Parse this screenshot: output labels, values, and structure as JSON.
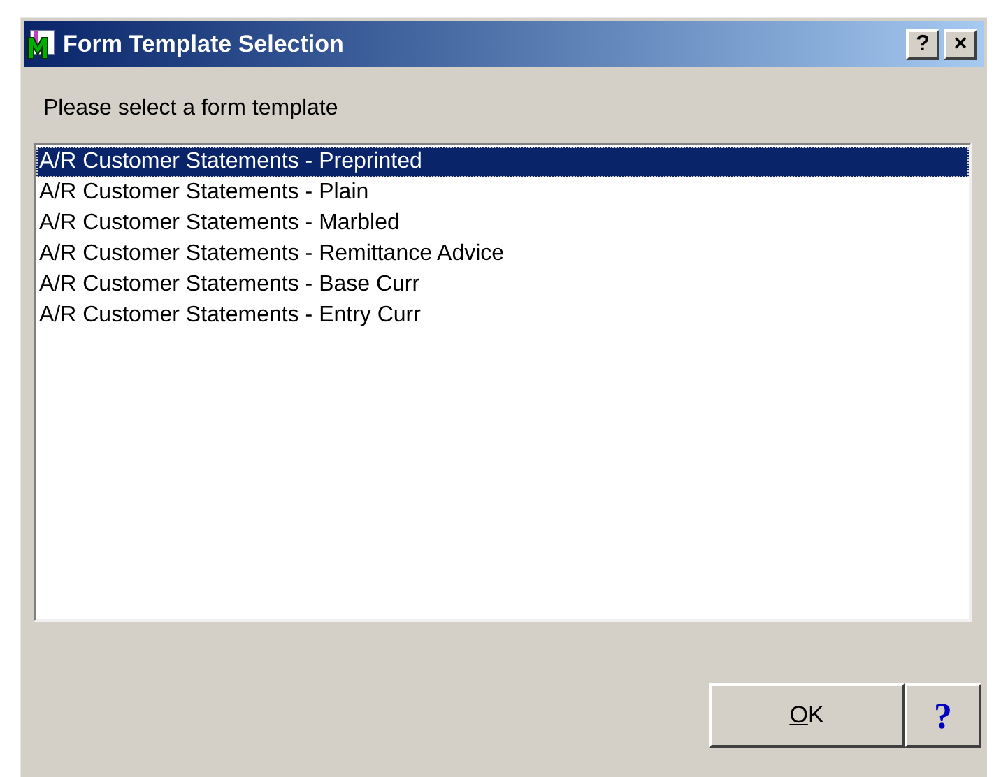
{
  "window": {
    "title": "Form Template Selection",
    "title_buttons": [
      "?",
      "×"
    ]
  },
  "prompt": "Please select a form template",
  "templates": [
    {
      "label": "A/R Customer Statements - Preprinted",
      "selected": true
    },
    {
      "label": "A/R Customer Statements - Plain",
      "selected": false
    },
    {
      "label": "A/R Customer Statements - Marbled",
      "selected": false
    },
    {
      "label": "A/R Customer Statements - Remittance Advice",
      "selected": false
    },
    {
      "label": "A/R Customer Statements - Base Curr",
      "selected": false
    },
    {
      "label": "A/R Customer Statements - Entry Curr",
      "selected": false
    }
  ],
  "buttons": {
    "ok": {
      "label": "OK",
      "mnemonic_underlined": true
    },
    "help": "?"
  }
}
